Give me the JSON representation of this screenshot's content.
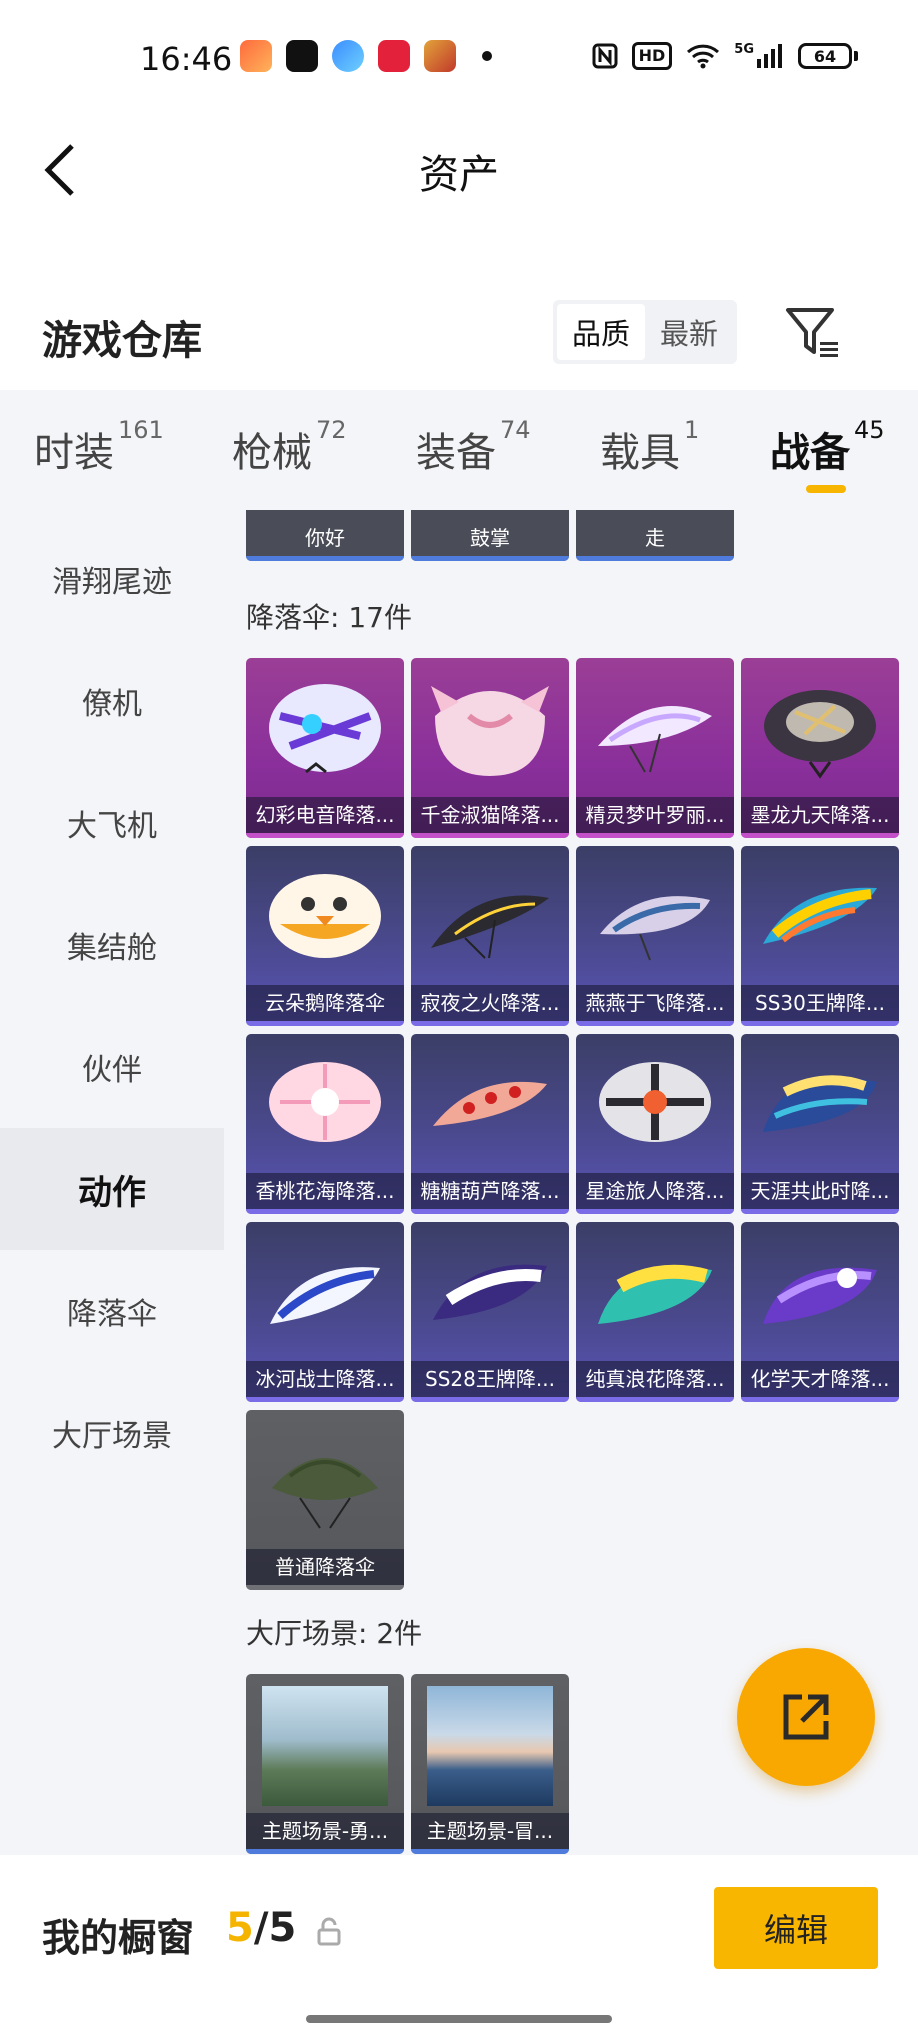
{
  "status_bar": {
    "time": "16:46",
    "hd_label": "HD",
    "network": "5G",
    "battery": "64",
    "app_icons": [
      "game-icon",
      "tiktok-icon",
      "browser-icon",
      "music-icon",
      "promo-app-icon"
    ]
  },
  "header": {
    "back_icon": "chevron-left-icon",
    "title": "资产"
  },
  "warehouse": {
    "title": "游戏仓库",
    "sort_options": [
      "品质",
      "最新"
    ],
    "selected_sort": "品质",
    "filter_icon": "filter-icon"
  },
  "tabs": [
    {
      "label": "时装",
      "count": "161"
    },
    {
      "label": "枪械",
      "count": "72"
    },
    {
      "label": "装备",
      "count": "74"
    },
    {
      "label": "载具",
      "count": "1"
    },
    {
      "label": "战备",
      "count": "45",
      "active": true
    }
  ],
  "sidebar": [
    {
      "label": "滑翔尾迹"
    },
    {
      "label": "僚机"
    },
    {
      "label": "大飞机"
    },
    {
      "label": "集结舱"
    },
    {
      "label": "伙伴"
    },
    {
      "label": "动作",
      "active": true
    },
    {
      "label": "降落伞"
    },
    {
      "label": "大厅场景"
    }
  ],
  "actions_partial": [
    "你好",
    "鼓掌",
    "走"
  ],
  "parachutes": {
    "title": "降落伞: 17件",
    "items": [
      {
        "name": "幻彩电音降落...",
        "quality": "purple"
      },
      {
        "name": "千金淑猫降落...",
        "quality": "purple"
      },
      {
        "name": "精灵梦叶罗丽...",
        "quality": "purple"
      },
      {
        "name": "墨龙九天降落...",
        "quality": "purple"
      },
      {
        "name": "云朵鹅降落伞",
        "quality": "blue"
      },
      {
        "name": "寂夜之火降落...",
        "quality": "blue"
      },
      {
        "name": "燕燕于飞降落...",
        "quality": "blue"
      },
      {
        "name": "SS30王牌降...",
        "quality": "blue"
      },
      {
        "name": "香桃花海降落...",
        "quality": "blue"
      },
      {
        "name": "糖糖葫芦降落...",
        "quality": "blue"
      },
      {
        "name": "星途旅人降落...",
        "quality": "blue"
      },
      {
        "name": "天涯共此时降...",
        "quality": "blue"
      },
      {
        "name": "冰河战士降落...",
        "quality": "blue"
      },
      {
        "name": "SS28王牌降...",
        "quality": "blue"
      },
      {
        "name": "纯真浪花降落...",
        "quality": "blue"
      },
      {
        "name": "化学天才降落...",
        "quality": "blue"
      },
      {
        "name": "普通降落伞",
        "quality": "grey"
      }
    ]
  },
  "lobby_scenes": {
    "title": "大厅场景: 2件",
    "items": [
      {
        "name": "主题场景-勇..."
      },
      {
        "name": "主题场景-冒..."
      }
    ]
  },
  "fab_icon": "share-icon",
  "showcase": {
    "title": "我的橱窗",
    "used": "5",
    "separator": "/",
    "total": "5",
    "lock_icon": "lock-icon",
    "edit_label": "编辑"
  },
  "colors": {
    "accent": "#f8b600",
    "purple_quality": "#9a3e96",
    "blue_quality": "#4c4a92"
  }
}
